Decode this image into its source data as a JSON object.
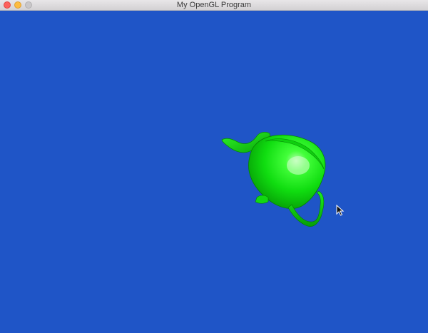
{
  "window": {
    "title": "My OpenGL Program"
  },
  "viewport": {
    "background_color": "#1f55c7",
    "object": {
      "name": "teapot",
      "color": "#12e812"
    }
  },
  "cursor": {
    "icon": "arrow-cursor-icon"
  }
}
